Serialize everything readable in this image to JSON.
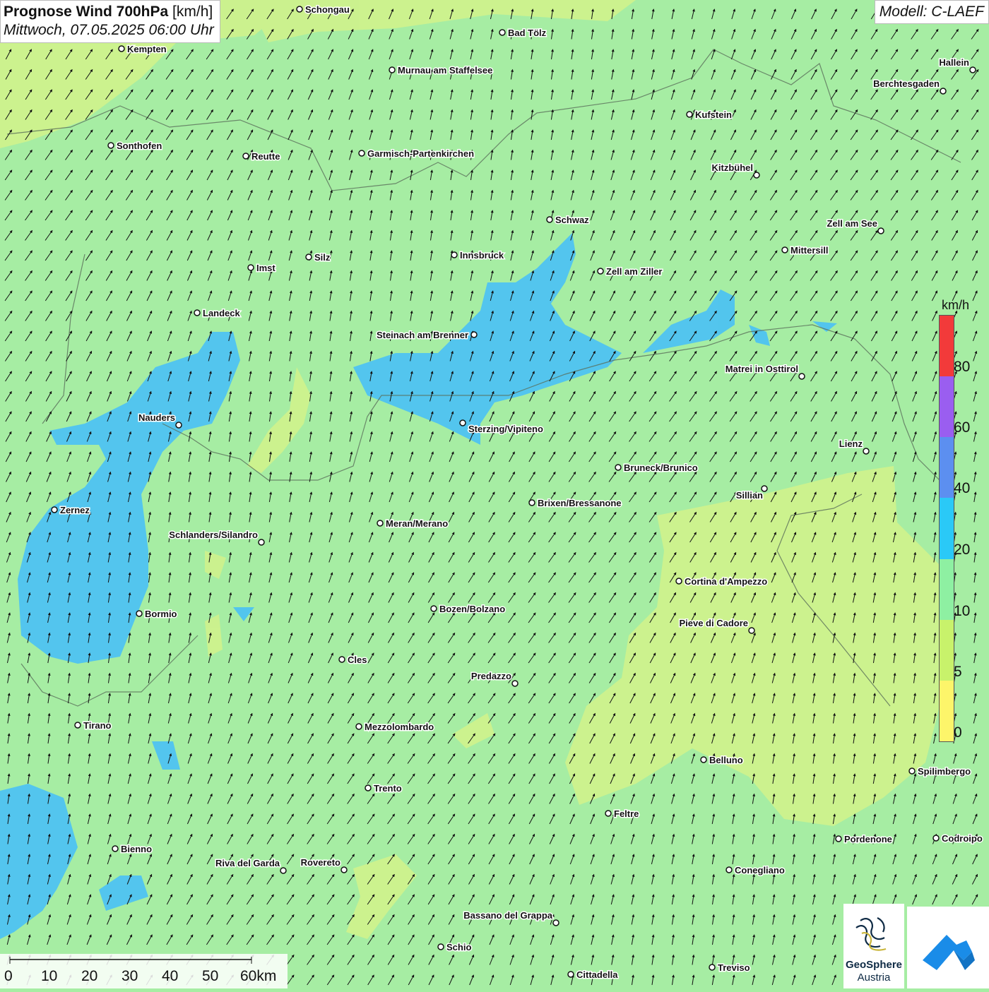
{
  "header": {
    "title_bold": "Prognose Wind 700hPa",
    "title_unit": "[km/h]",
    "datetime": "Mittwoch, 07.05.2025 06:00 Uhr",
    "model": "Modell: C-LAEF"
  },
  "legend": {
    "unit": "km/h",
    "labels": [
      "0",
      "5",
      "10",
      "20",
      "40",
      "60",
      "80"
    ],
    "colors": [
      "#fdf56a",
      "#c8f26b",
      "#8ef0a2",
      "#2ac9f7",
      "#5c8ff0",
      "#9a5ef0",
      "#f23a3a"
    ]
  },
  "scalebar": {
    "labels": [
      "0",
      "10",
      "20",
      "30",
      "40",
      "50",
      "60km"
    ]
  },
  "logos": {
    "geosphere_line1": "GeoSphere",
    "geosphere_line2": "Austria"
  },
  "cities": [
    {
      "name": "Schongau"
    },
    {
      "name": "Bad Tölz"
    },
    {
      "name": "Kempten"
    },
    {
      "name": "Murnau am Staffelsee"
    },
    {
      "name": "Hallein"
    },
    {
      "name": "Berchtesgaden"
    },
    {
      "name": "Kufstein"
    },
    {
      "name": "Sonthofen"
    },
    {
      "name": "Reutte"
    },
    {
      "name": "Garmisch-Partenkirchen"
    },
    {
      "name": "Kitzbühel"
    },
    {
      "name": "Schwaz"
    },
    {
      "name": "Zell am See"
    },
    {
      "name": "Mittersill"
    },
    {
      "name": "Innsbruck"
    },
    {
      "name": "Silz"
    },
    {
      "name": "Imst"
    },
    {
      "name": "Zell am Ziller"
    },
    {
      "name": "Landeck"
    },
    {
      "name": "Steinach am Brenner"
    },
    {
      "name": "Matrei in Osttirol"
    },
    {
      "name": "Nauders"
    },
    {
      "name": "Sterzing/Vipiteno"
    },
    {
      "name": "Lienz"
    },
    {
      "name": "Bruneck/Brunico"
    },
    {
      "name": "Sillian"
    },
    {
      "name": "Zernez"
    },
    {
      "name": "Brixen/Bressanone"
    },
    {
      "name": "Meran/Merano"
    },
    {
      "name": "Schlanders/Silandro"
    },
    {
      "name": "Cortina d'Ampezzo"
    },
    {
      "name": "Bormio"
    },
    {
      "name": "Bozen/Bolzano"
    },
    {
      "name": "Pieve di Cadore"
    },
    {
      "name": "Cles"
    },
    {
      "name": "Predazzo"
    },
    {
      "name": "Tirano"
    },
    {
      "name": "Mezzolombardo"
    },
    {
      "name": "Belluno"
    },
    {
      "name": "Spilimbergo"
    },
    {
      "name": "Trento"
    },
    {
      "name": "Feltre"
    },
    {
      "name": "Pordenone"
    },
    {
      "name": "Codroipo"
    },
    {
      "name": "Bienno"
    },
    {
      "name": "Riva del Garda"
    },
    {
      "name": "Rovereto"
    },
    {
      "name": "Conegliano"
    },
    {
      "name": "Bassano del Grappa"
    },
    {
      "name": "Schio"
    },
    {
      "name": "Treviso"
    },
    {
      "name": "Cittadella"
    }
  ]
}
